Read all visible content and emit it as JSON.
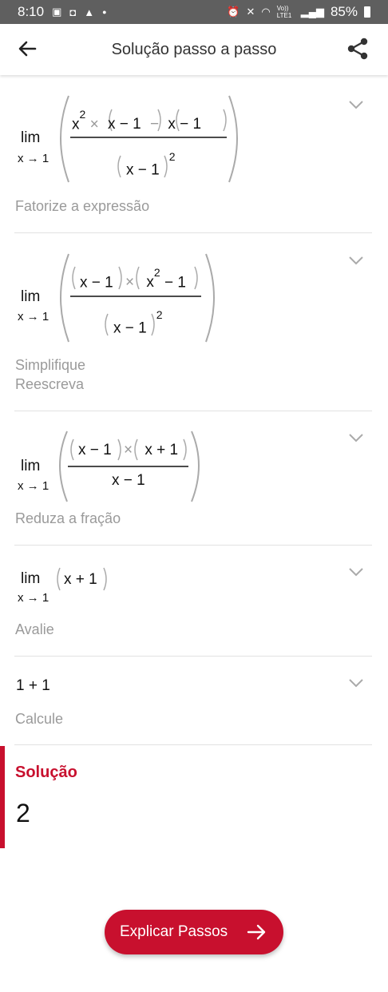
{
  "status_bar": {
    "time": "8:10",
    "battery": "85%",
    "left_icons": [
      "image-icon",
      "message-icon",
      "warning-icon",
      "dot-icon"
    ],
    "right_icons": [
      "alarm-icon",
      "mute-icon",
      "wifi-icon",
      "volte-icon",
      "signal-icon",
      "battery-icon"
    ],
    "volte_label": "Vo)) LTE1"
  },
  "app_bar": {
    "title": "Solução passo a passo",
    "back_icon": "arrow-left-icon",
    "share_icon": "share-icon"
  },
  "limit": {
    "lim": "lim",
    "sub": "x → 1"
  },
  "steps": [
    {
      "expression": "lim x→1 ( (x^2 × (x − 1) − (x − 1)) / (x − 1)^2 )",
      "numerator": {
        "a": "x",
        "a_exp": "2",
        "times": "×",
        "b": "x − 1",
        "minus": "−",
        "c": "x − 1"
      },
      "denominator": {
        "base": "x − 1",
        "exp": "2"
      },
      "description": "Fatorize a expressão"
    },
    {
      "expression": "lim x→1 ( ((x − 1) × (x^2 − 1)) / (x − 1)^2 )",
      "numerator": {
        "a": "x − 1",
        "times": "×",
        "b_base": "x",
        "b_exp": "2",
        "b_rest": "− 1"
      },
      "denominator": {
        "base": "x − 1",
        "exp": "2"
      },
      "description_lines": [
        "Simplifique",
        "Reescreva"
      ]
    },
    {
      "expression": "lim x→1 ( ((x − 1) × (x + 1)) / (x − 1) )",
      "numerator": {
        "a": "x − 1",
        "times": "×",
        "b": "x + 1"
      },
      "denominator": "x − 1",
      "description": "Reduza a fração"
    },
    {
      "expression": "lim x→1 (x + 1)",
      "body": "x + 1",
      "description": "Avalie"
    },
    {
      "expression": "1 + 1",
      "description": "Calcule"
    }
  ],
  "solution": {
    "title": "Solução",
    "value": "2"
  },
  "cta": {
    "label": "Explicar Passos",
    "icon": "arrow-right-icon"
  },
  "colors": {
    "accent": "#c8102e",
    "status_bar": "#5f5f5f",
    "muted_text": "#9a9a9a"
  }
}
